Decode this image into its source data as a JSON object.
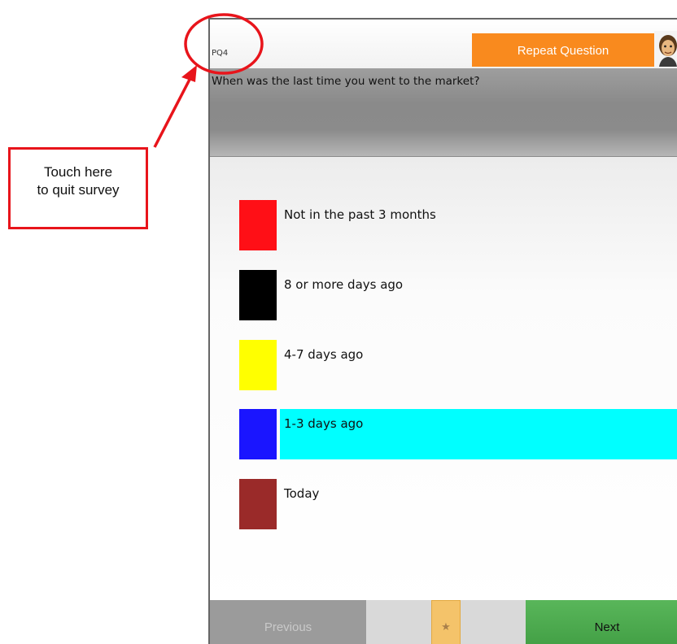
{
  "header": {
    "question_code": "PQ4",
    "repeat_label": "Repeat Question"
  },
  "question": {
    "text": "When was the last time you went to the market?"
  },
  "options": [
    {
      "label": "Not in the past 3 months",
      "color": "#ff0f16",
      "selected": false
    },
    {
      "label": "8 or more days ago",
      "color": "#000000",
      "selected": false
    },
    {
      "label": "4-7 days ago",
      "color": "#ffff00",
      "selected": false
    },
    {
      "label": "1-3 days ago",
      "color": "#1a15ff",
      "selected": true
    },
    {
      "label": "Today",
      "color": "#9a2a29",
      "selected": false
    }
  ],
  "footer": {
    "previous_label": "Previous",
    "star_symbol": "★",
    "next_label": "Next"
  },
  "annotation": {
    "line1": "Touch here",
    "line2": "to quit survey",
    "color": "#e8141b"
  },
  "icons": {
    "avatar": "person-avatar-icon",
    "star": "star-icon"
  }
}
